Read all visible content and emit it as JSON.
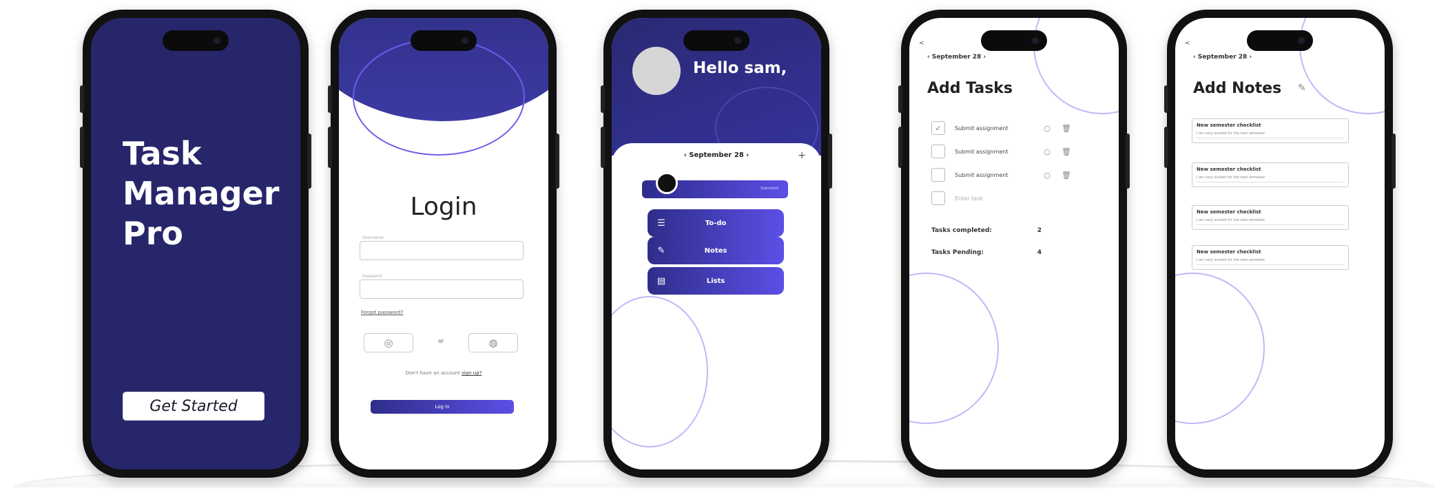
{
  "splash": {
    "title_line1": "Task",
    "title_line2": "Manager",
    "title_line3": "Pro",
    "cta_label": "Get Started"
  },
  "login": {
    "title": "Login",
    "username_label": "Username",
    "password_label": "Password",
    "forgot_label": "Forgot password?",
    "google_icon": "google-icon",
    "or_label": "or",
    "facebook_icon": "globe-icon",
    "signup_prompt": "Don't have an account",
    "signup_link": "sign up?",
    "submit_label": "Log in"
  },
  "dashboard": {
    "greeting": "Hello sam,",
    "date": "September 28",
    "add_label": "+",
    "progress_label": "Submitted",
    "menu": [
      {
        "label": "To-do",
        "icon": "list-icon"
      },
      {
        "label": "Notes",
        "icon": "pencil-icon"
      },
      {
        "label": "Lists",
        "icon": "document-icon"
      }
    ]
  },
  "tasks": {
    "back": "<",
    "date": "September 28",
    "title": "Add Tasks",
    "items": [
      {
        "text": "Submit assignment",
        "checked": true
      },
      {
        "text": "Submit assignment",
        "checked": false
      },
      {
        "text": "Submit assignment",
        "checked": false
      }
    ],
    "new_placeholder": "Enter task",
    "completed_label": "Tasks completed:",
    "completed_value": "2",
    "pending_label": "Tasks Pending:",
    "pending_value": "4"
  },
  "notes": {
    "back": "<",
    "date": "September 28",
    "title": "Add Notes",
    "items": [
      {
        "title": "New semester checklist",
        "body": "I am very excited for the next semester"
      },
      {
        "title": "New semester checklist",
        "body": "I am very excited for the next semester"
      },
      {
        "title": "New semester checklist",
        "body": "I am very excited for the next semester"
      },
      {
        "title": "New semester checklist",
        "body": "I am very excited for the next semester"
      }
    ]
  },
  "colors": {
    "brand_dark": "#27266b",
    "brand_light": "#5b4fe6",
    "ring": "#8d7df2"
  }
}
